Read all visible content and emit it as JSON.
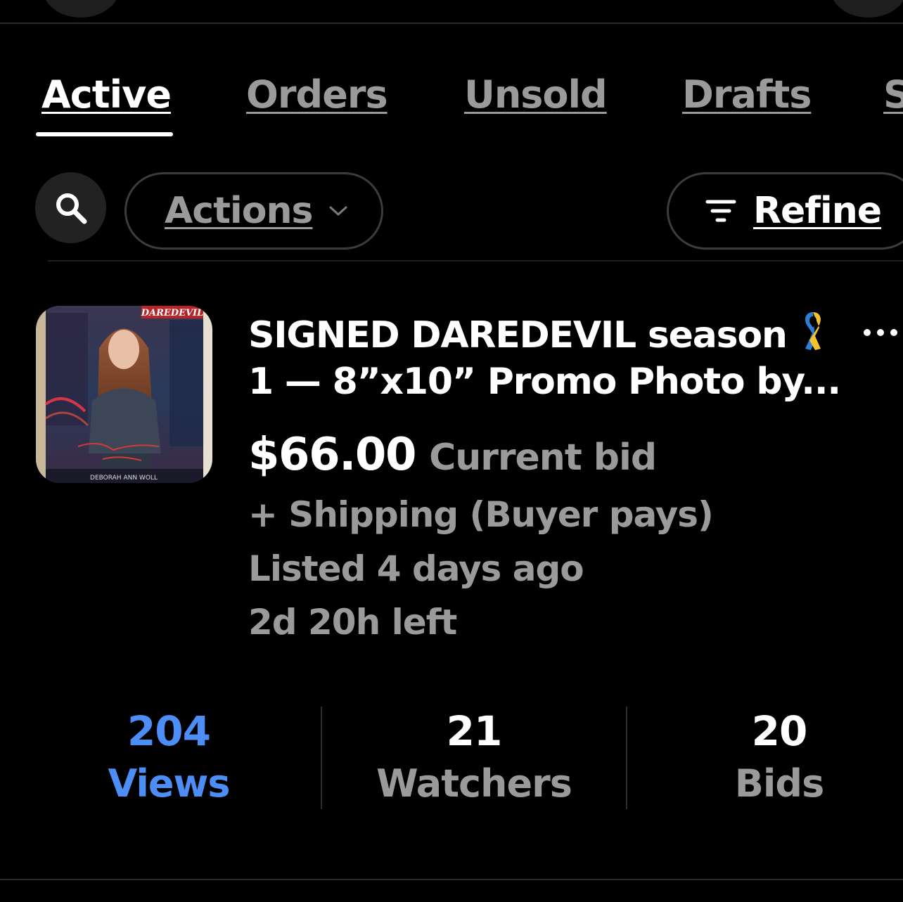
{
  "tabs": [
    {
      "label": "Active",
      "active": true
    },
    {
      "label": "Orders",
      "active": false
    },
    {
      "label": "Unsold",
      "active": false
    },
    {
      "label": "Drafts",
      "active": false
    },
    {
      "label": "S",
      "active": false
    }
  ],
  "toolbar": {
    "search_icon": "search-icon",
    "actions_label": "Actions",
    "refine_label": "Refine"
  },
  "listing": {
    "title_line1": "SIGNED DAREDEVIL season",
    "title_line2": "1 — 8”x10” Promo Photo by...",
    "title_icon": "awareness-ribbon-icon",
    "thumbnail_caption": "DEBORAH ANN WOLL",
    "thumbnail_logo": "DAREDEVIL",
    "price": "$66.00",
    "price_label": "Current bid",
    "shipping": "+ Shipping (Buyer pays)",
    "listed": "Listed 4 days ago",
    "time_left": "2d 20h left"
  },
  "stats": [
    {
      "value": "204",
      "label": "Views"
    },
    {
      "value": "21",
      "label": "Watchers"
    },
    {
      "value": "20",
      "label": "Bids"
    }
  ],
  "colors": {
    "background": "#000000",
    "accent_blue": "#4c8df6",
    "muted_text": "#9a9a9a"
  }
}
